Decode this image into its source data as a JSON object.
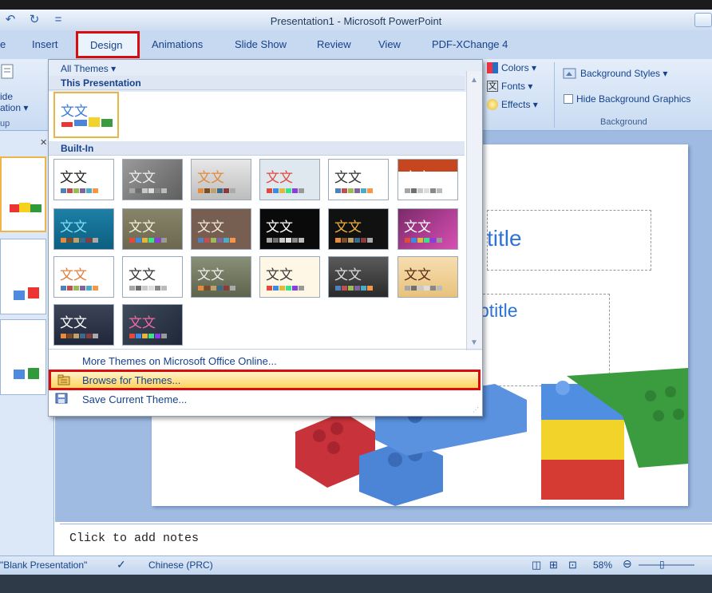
{
  "window": {
    "title": "Presentation1 - Microsoft PowerPoint"
  },
  "qat": {
    "undo_glyph": "↶",
    "separator": "="
  },
  "tabs": [
    {
      "label": "e"
    },
    {
      "label": "Insert"
    },
    {
      "label": "Design"
    },
    {
      "label": "Animations"
    },
    {
      "label": "Slide Show"
    },
    {
      "label": "Review"
    },
    {
      "label": "View"
    },
    {
      "label": "PDF-XChange 4"
    }
  ],
  "ribbon": {
    "left_group": {
      "line1": "ide",
      "line2": "ation ▾",
      "group_label": "up"
    },
    "theme_options": {
      "colors": "Colors ▾",
      "fonts": "Fonts ▾",
      "effects": "Effects ▾"
    },
    "background": {
      "styles": "Background Styles ▾",
      "hide_graphics": "Hide Background Graphics",
      "group_label": "Background"
    }
  },
  "themes_gallery": {
    "header": "All Themes ▾",
    "section_this": "This Presentation",
    "section_builtin": "Built-In",
    "tile_text": "文文",
    "menu": {
      "more_themes": "More Themes on Microsoft Office Online...",
      "browse": "Browse for Themes...",
      "save": "Save Current Theme..."
    }
  },
  "slide": {
    "title_partial": "title",
    "subtitle_partial": "btitle"
  },
  "notes": {
    "placeholder": "Click to add notes"
  },
  "status": {
    "theme": "\"Blank Presentation\"",
    "language": "Chinese (PRC)",
    "zoom": "58%"
  },
  "colors": {
    "highlight_red": "#d80e0e",
    "ribbon_blue": "#c7d9f0",
    "text_blue": "#15428b"
  }
}
